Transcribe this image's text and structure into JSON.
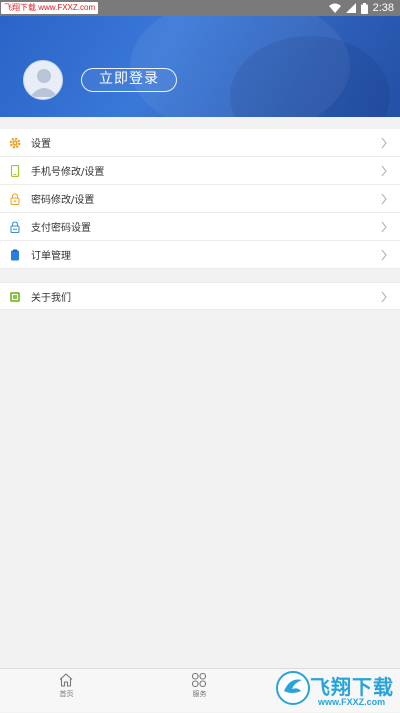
{
  "status_bar": {
    "watermark": "飞翔下载 www.FXXZ.com",
    "time": "2:38"
  },
  "header": {
    "login_label": "立即登录"
  },
  "menu_group_1": [
    {
      "label": "设置",
      "icon": "gear-icon",
      "color": "#f0a020"
    },
    {
      "label": "手机号修改/设置",
      "icon": "phone-icon",
      "color": "#9cc83a"
    },
    {
      "label": "密码修改/设置",
      "icon": "lock-icon",
      "color": "#f0a020"
    },
    {
      "label": "支付密码设置",
      "icon": "padlock-icon",
      "color": "#3a8fd8"
    },
    {
      "label": "订单管理",
      "icon": "clipboard-icon",
      "color": "#2a7fd8"
    }
  ],
  "menu_group_2": [
    {
      "label": "关于我们",
      "icon": "info-icon",
      "color": "#8bc34a"
    }
  ],
  "tabbar": {
    "tabs": [
      {
        "label": "首页",
        "icon": "home-icon"
      },
      {
        "label": "服务",
        "icon": "grid-icon"
      }
    ]
  },
  "brand_watermark": {
    "text": "飞翔下载",
    "url": "www.FXXZ.com"
  },
  "colors": {
    "header_blue": "#2a64c8",
    "chevron": "#bbbbbb"
  }
}
